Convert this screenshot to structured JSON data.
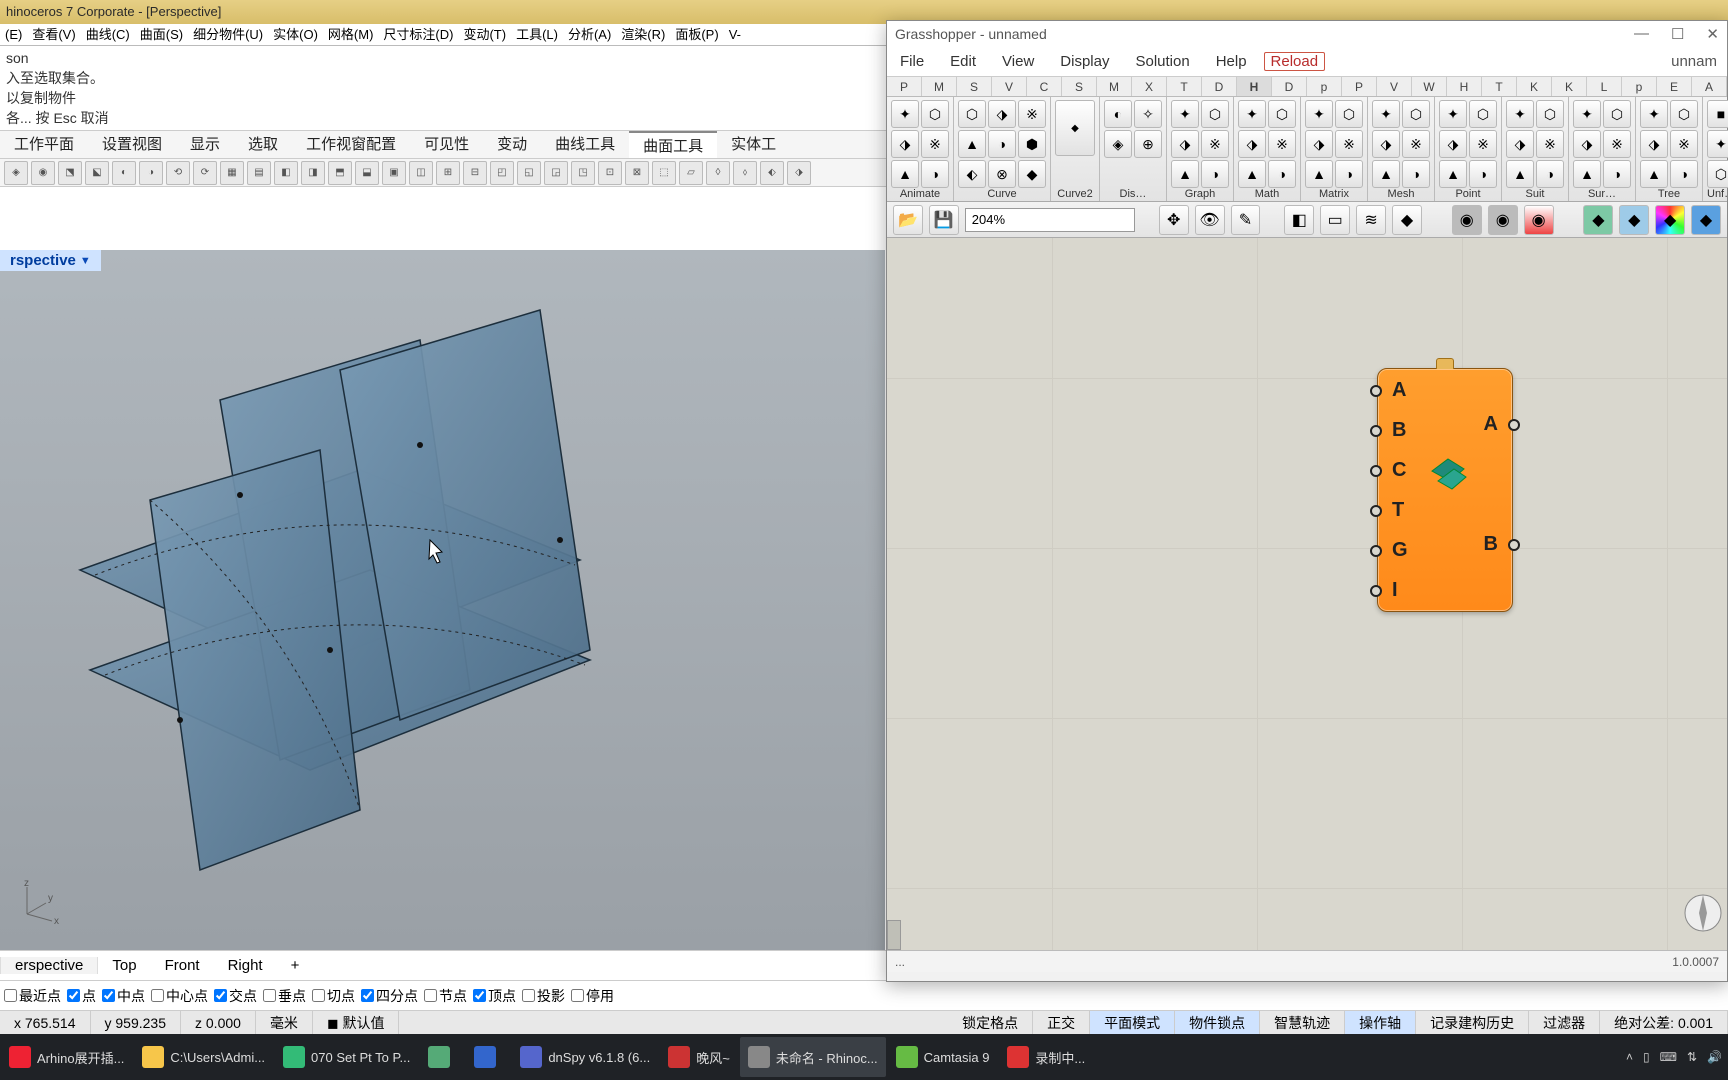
{
  "rhino": {
    "title": "hinoceros 7 Corporate - [Perspective]",
    "menu": [
      "(E)",
      "查看(V)",
      "曲线(C)",
      "曲面(S)",
      "细分物件(U)",
      "实体(O)",
      "网格(M)",
      "尺寸标注(D)",
      "变动(T)",
      "工具(L)",
      "分析(A)",
      "渲染(R)",
      "面板(P)",
      "V-"
    ],
    "cmd": [
      "son",
      "入至选取集合。",
      "以复制物件",
      "各... 按 Esc 取消"
    ],
    "tabs": [
      "工作平面",
      "设置视图",
      "显示",
      "选取",
      "工作视窗配置",
      "可见性",
      "变动",
      "曲线工具",
      "曲面工具",
      "实体工"
    ],
    "active_tab": 8,
    "viewport_name": "rspective",
    "views": [
      "erspective",
      "Top",
      "Front",
      "Right",
      "+"
    ],
    "osnap": [
      {
        "l": "最近点",
        "c": false
      },
      {
        "l": "点",
        "c": true
      },
      {
        "l": "中点",
        "c": true
      },
      {
        "l": "中心点",
        "c": false
      },
      {
        "l": "交点",
        "c": true
      },
      {
        "l": "垂点",
        "c": false
      },
      {
        "l": "切点",
        "c": false
      },
      {
        "l": "四分点",
        "c": true
      },
      {
        "l": "节点",
        "c": false
      },
      {
        "l": "顶点",
        "c": true
      },
      {
        "l": "投影",
        "c": false
      },
      {
        "l": "停用",
        "c": false
      }
    ],
    "status": {
      "x": "x 765.514",
      "y": "y 959.235",
      "z": "z 0.000",
      "unit": "毫米",
      "layer_label": "默认值",
      "items": [
        "锁定格点",
        "正交",
        "平面模式",
        "物件锁点",
        "智慧轨迹",
        "操作轴",
        "记录建构历史",
        "过滤器"
      ],
      "active": [
        2,
        3,
        5
      ],
      "tol": "绝对公差: 0.001"
    }
  },
  "taskbar": {
    "items": [
      {
        "label": "Arhino展开插...",
        "color": "#e23"
      },
      {
        "label": "C:\\Users\\Admi...",
        "color": "#f7c64a"
      },
      {
        "label": "070 Set Pt To P...",
        "color": "#3b7"
      },
      {
        "label": "",
        "color": "#5a7"
      },
      {
        "label": "",
        "color": "#36c"
      },
      {
        "label": "dnSpy v6.1.8 (6...",
        "color": "#56c"
      },
      {
        "label": "晚风~",
        "color": "#c33"
      },
      {
        "label": "未命名 - Rhinoc...",
        "color": "#888"
      },
      {
        "label": "Camtasia 9",
        "color": "#6b4"
      },
      {
        "label": "录制中...",
        "color": "#d33"
      }
    ],
    "active": [
      7
    ]
  },
  "gh": {
    "title": "Grasshopper - unnamed",
    "menu": [
      "File",
      "Edit",
      "View",
      "Display",
      "Solution",
      "Help"
    ],
    "reload": "Reload",
    "docname": "unnam",
    "tabs": [
      "P",
      "M",
      "S",
      "V",
      "C",
      "S",
      "M",
      "X",
      "T",
      "D",
      "H",
      "D",
      "p",
      "P",
      "V",
      "W",
      "H",
      "T",
      "K",
      "K",
      "L",
      "p",
      "E",
      "A"
    ],
    "active_tab": 10,
    "groups": [
      {
        "label": "Animate",
        "cols": 2,
        "n": 6
      },
      {
        "label": "Curve",
        "cols": 3,
        "n": 9
      },
      {
        "label": "Curve2",
        "cols": 1,
        "big": true,
        "n": 1
      },
      {
        "label": "Dis…",
        "cols": 2,
        "n": 4
      },
      {
        "label": "Graph",
        "cols": 2,
        "n": 6
      },
      {
        "label": "Math",
        "cols": 2,
        "n": 6
      },
      {
        "label": "Matrix",
        "cols": 2,
        "n": 6
      },
      {
        "label": "Mesh",
        "cols": 2,
        "n": 6
      },
      {
        "label": "Point",
        "cols": 2,
        "n": 6
      },
      {
        "label": "Suit",
        "cols": 2,
        "n": 6
      },
      {
        "label": "Sur…",
        "cols": 2,
        "n": 6
      },
      {
        "label": "Tree",
        "cols": 2,
        "n": 6
      },
      {
        "label": "Unf…",
        "cols": 1,
        "n": 3
      }
    ],
    "zoom": "204%",
    "component": {
      "inputs": [
        "A",
        "B",
        "C",
        "T",
        "G",
        "I"
      ],
      "outputs": [
        "A",
        "B"
      ]
    },
    "status_left": "...",
    "status_right": "1.0.0007"
  }
}
